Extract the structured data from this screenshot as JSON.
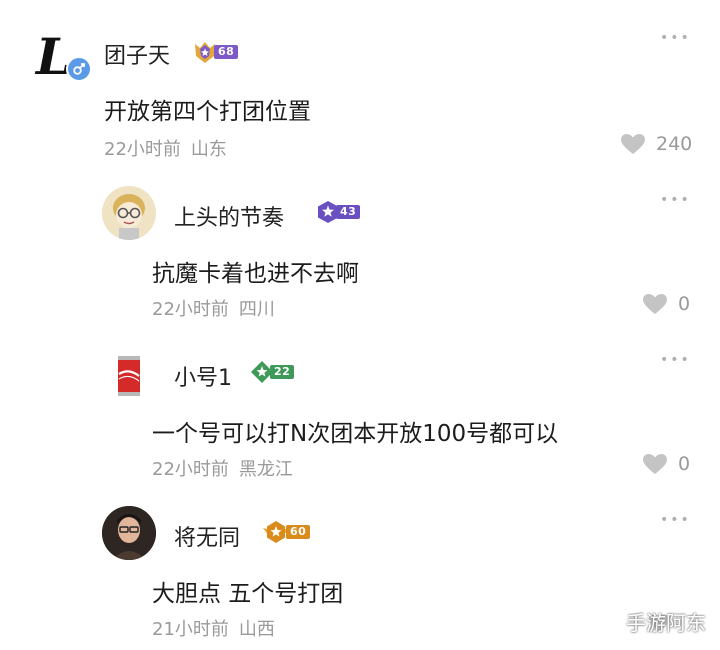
{
  "comments": [
    {
      "username": "团子天",
      "level": "68",
      "text": "开放第四个打团位置",
      "time": "22小时前",
      "location": "山东",
      "likes": "240",
      "more": "•••",
      "badge_color": "#7c5bc8",
      "avatar_icon": "letter-l-logo-icon",
      "gender_icon": "male-icon"
    },
    {
      "username": "上头的节奏",
      "level": "43",
      "text": "抗魔卡着也进不去啊",
      "time": "22小时前",
      "location": "四川",
      "likes": "0",
      "more": "•••",
      "badge_color": "#6a4fc0",
      "avatar_icon": "cartoon-glasses-avatar-icon"
    },
    {
      "username": "小号1",
      "level": "22",
      "text": "一个号可以打N次团本开放100号都可以",
      "time": "22小时前",
      "location": "黑龙江",
      "likes": "0",
      "more": "•••",
      "badge_color": "#3f9a5a",
      "avatar_icon": "cola-can-avatar-icon"
    },
    {
      "username": "将无同",
      "level": "60",
      "text": "大胆点 五个号打团",
      "time": "21小时前",
      "location": "山西",
      "more": "•••",
      "badge_color": "#d98b1c",
      "avatar_icon": "person-photo-avatar-icon"
    }
  ],
  "watermark": "手游阿东"
}
